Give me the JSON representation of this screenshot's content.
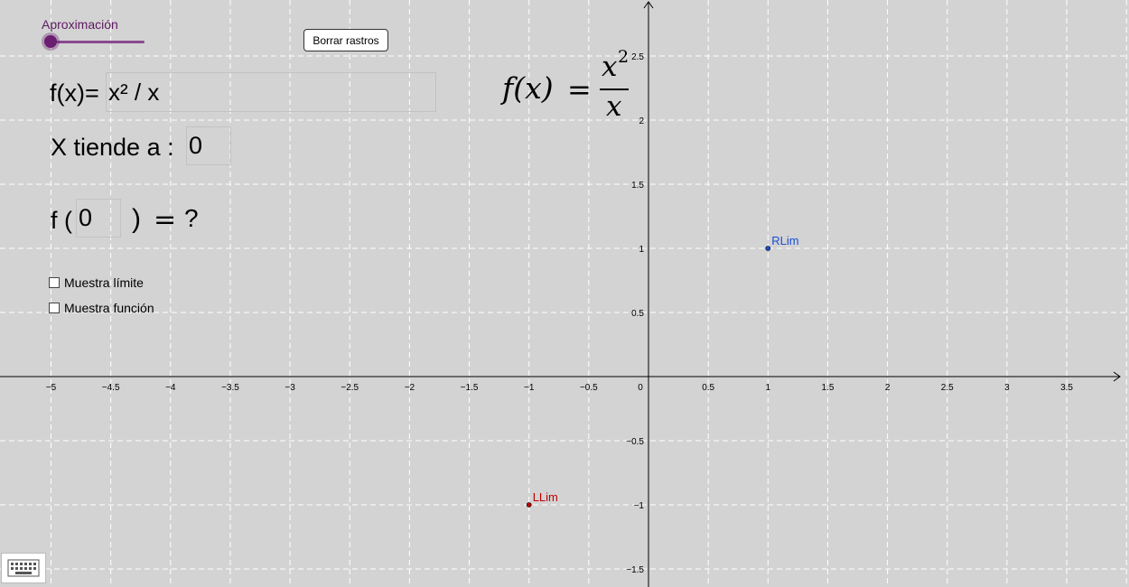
{
  "slider": {
    "label": "Aproximación",
    "value": 0
  },
  "button": {
    "label": "Borrar rastros"
  },
  "function_row": {
    "label": "f(x)=",
    "value": "x² / x"
  },
  "tends_row": {
    "label": "X tiende a :",
    "value": "0"
  },
  "eval_row": {
    "prefix": "f (",
    "value": "0",
    "suffix": ")",
    "equals": "=",
    "result": "?"
  },
  "checkboxes": [
    {
      "label": "Muestra límite",
      "checked": false
    },
    {
      "label": "Muestra función",
      "checked": false
    }
  ],
  "formula": {
    "lhs": "f(x)",
    "eq": "=",
    "numerator": "x",
    "exponent": "2",
    "denominator": "x"
  },
  "axes": {
    "x_ticks": [
      "−5",
      "−4.5",
      "−4",
      "−3.5",
      "−3",
      "−2.5",
      "−2",
      "−1.5",
      "−1",
      "−0.5",
      "0",
      "0.5",
      "1",
      "1.5",
      "2",
      "2.5",
      "3",
      "3.5"
    ],
    "y_ticks": [
      "2.5",
      "2",
      "1.5",
      "1",
      "0.5",
      "−0.5",
      "−1",
      "−1.5"
    ]
  },
  "points": [
    {
      "label": "RLim",
      "x": 1,
      "y": 1,
      "color": "#1a4fd6"
    },
    {
      "label": "LLim",
      "x": -1,
      "y": -1,
      "color": "#c00000"
    }
  ],
  "colors": {
    "background": "#d3d3d3",
    "grid": "#ffffff",
    "slider": "#6b1f70"
  },
  "icons": {
    "keyboard": "keyboard-icon"
  }
}
